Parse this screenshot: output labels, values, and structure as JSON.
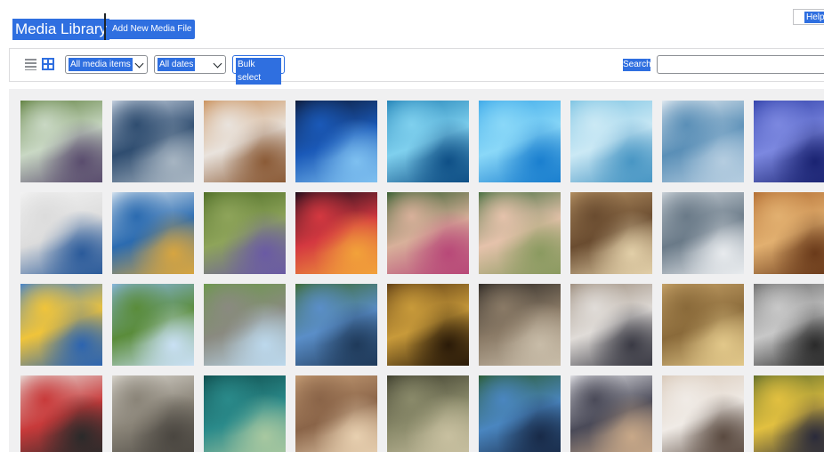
{
  "header": {
    "title": "Media Library",
    "add_new_label": "Add New Media File",
    "help_label": "Help"
  },
  "toolbar": {
    "view_list_label": "List view",
    "view_grid_label": "Grid view",
    "media_type_selected": "All media items",
    "date_selected": "All dates",
    "bulk_select_label": "Bulk select",
    "search_label": "Search",
    "search_value": ""
  },
  "colors": {
    "accent": "#2f6fe0",
    "grid_bg": "#f0f0f1",
    "border": "#dcdcde"
  },
  "media_items": [
    {
      "name": "people-walking-forest",
      "colors": [
        "#5c7d3a",
        "#c9d8c4",
        "#5a4d6e"
      ]
    },
    {
      "name": "frosty-lake",
      "colors": [
        "#cfd9e6",
        "#2f4d70",
        "#a7b5c2"
      ]
    },
    {
      "name": "hands-on-laptop",
      "colors": [
        "#c98d55",
        "#e9e3dd",
        "#8b5b37"
      ]
    },
    {
      "name": "water-pouring-bottle",
      "colors": [
        "#0d1730",
        "#1a59b8",
        "#7ec0f0"
      ]
    },
    {
      "name": "water-droplets-blue",
      "colors": [
        "#1f7fb4",
        "#7fd0ee",
        "#0e4f86"
      ]
    },
    {
      "name": "pool-water-surface",
      "colors": [
        "#3aa7e8",
        "#8ad8f8",
        "#1a7fcf"
      ]
    },
    {
      "name": "rain-drops-glass",
      "colors": [
        "#7ac2e2",
        "#cbe9f5",
        "#4896c4"
      ]
    },
    {
      "name": "water-drop-ripple",
      "colors": [
        "#e8eef3",
        "#5a8fb7",
        "#b5cde0"
      ]
    },
    {
      "name": "blue-circuit-board",
      "colors": [
        "#2f3fa8",
        "#7c88e0",
        "#1a2372"
      ]
    },
    {
      "name": "spreadsheet-bar-chart",
      "colors": [
        "#f4f4f4",
        "#dcdcdc",
        "#2a5a9a"
      ]
    },
    {
      "name": "padlock-globe",
      "colors": [
        "#dfeaf2",
        "#2b6bb0",
        "#d7a540"
      ]
    },
    {
      "name": "bluebell-forest",
      "colors": [
        "#4a6a24",
        "#8ea45a",
        "#6a5aa4"
      ]
    },
    {
      "name": "fireworks-night",
      "colors": [
        "#100a18",
        "#d43840",
        "#f2a23a"
      ]
    },
    {
      "name": "elderly-woman-garden",
      "colors": [
        "#2d5a2a",
        "#d8b09a",
        "#b84878"
      ]
    },
    {
      "name": "smiling-elderly-woman",
      "colors": [
        "#3d6a3a",
        "#e5c2ab",
        "#8a9a60"
      ]
    },
    {
      "name": "ornate-building-facade",
      "colors": [
        "#b89466",
        "#6a4c30",
        "#e2cfa8"
      ]
    },
    {
      "name": "modern-building-plaza",
      "colors": [
        "#cfd6dc",
        "#6a7a88",
        "#e8ebee"
      ]
    },
    {
      "name": "grand-hall-interior",
      "colors": [
        "#b06a30",
        "#e2b070",
        "#6a3a1a"
      ]
    },
    {
      "name": "yellow-envelopes-blue",
      "colors": [
        "#3b7fd4",
        "#f0c43a",
        "#2c64b0"
      ]
    },
    {
      "name": "green-meadow-hill",
      "colors": [
        "#8ab8e8",
        "#5a8c3a",
        "#c9e0f4"
      ]
    },
    {
      "name": "standing-stone-field",
      "colors": [
        "#6a9a48",
        "#8a8a80",
        "#bcd8ec"
      ]
    },
    {
      "name": "dam-tower-reservoir",
      "colors": [
        "#3d6a2a",
        "#5a8ec8",
        "#1f3a5a"
      ]
    },
    {
      "name": "carved-wood-altar",
      "colors": [
        "#5a3a14",
        "#c89a3a",
        "#2a1a08"
      ]
    },
    {
      "name": "dark-artifact-display",
      "colors": [
        "#2a2622",
        "#8a7a66",
        "#c8bca8"
      ]
    },
    {
      "name": "people-at-computers",
      "colors": [
        "#9a8a7a",
        "#e0dcd8",
        "#3a3a44"
      ]
    },
    {
      "name": "dragonfly-fossil",
      "colors": [
        "#c8a46a",
        "#8a6a3a",
        "#e2c88a"
      ]
    },
    {
      "name": "helmets-chainmail",
      "colors": [
        "#6a6a6a",
        "#c8c8c8",
        "#2a2a2a"
      ]
    },
    {
      "name": "playing-cards-hand",
      "colors": [
        "#e8e4e0",
        "#c83a3a",
        "#2a2a2a"
      ]
    },
    {
      "name": "folded-newspapers",
      "colors": [
        "#dcd8d0",
        "#8a8478",
        "#4a4640"
      ]
    },
    {
      "name": "teal-sculpture-room",
      "colors": [
        "#0e4a4a",
        "#2a8a8a",
        "#a8c8a0"
      ]
    },
    {
      "name": "creation-of-adam",
      "colors": [
        "#c8a078",
        "#8a6448",
        "#e8d0b0"
      ]
    },
    {
      "name": "last-supper-painting",
      "colors": [
        "#3a3a2a",
        "#8a8a6a",
        "#c8c0a0"
      ]
    },
    {
      "name": "dam-tower-reservoir-2",
      "colors": [
        "#2a5a2a",
        "#4a86c0",
        "#182a48"
      ]
    },
    {
      "name": "typing-on-laptop",
      "colors": [
        "#e8e8ec",
        "#4a4a58",
        "#c8a888"
      ]
    },
    {
      "name": "writing-in-notebook",
      "colors": [
        "#d8c8b8",
        "#f0ebe6",
        "#5a4a40"
      ]
    },
    {
      "name": "students-in-classroom",
      "colors": [
        "#5a6a2a",
        "#e2c040",
        "#2a2a3a"
      ]
    }
  ]
}
